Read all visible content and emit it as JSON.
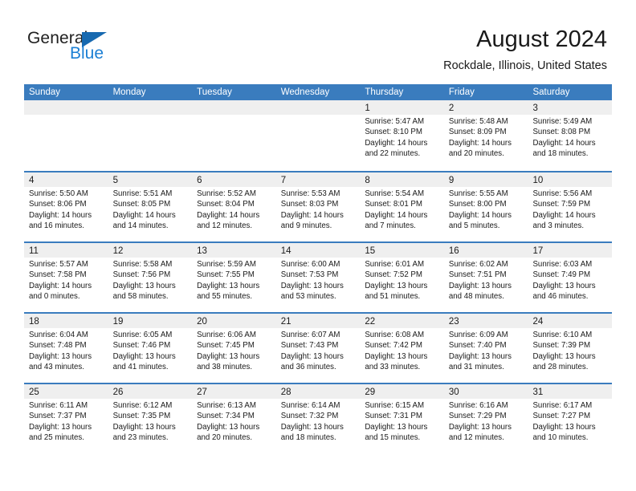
{
  "brand": {
    "name_dark": "General",
    "name_blue": "Blue",
    "triangle_icon": "triangle-icon",
    "accent_color": "#1b7fd4",
    "header_color": "#3a7cbe"
  },
  "header": {
    "title": "August 2024",
    "subtitle": "Rockdale, Illinois, United States"
  },
  "weekdays": [
    "Sunday",
    "Monday",
    "Tuesday",
    "Wednesday",
    "Thursday",
    "Friday",
    "Saturday"
  ],
  "weeks": [
    [
      {
        "day": "",
        "lines": []
      },
      {
        "day": "",
        "lines": []
      },
      {
        "day": "",
        "lines": []
      },
      {
        "day": "",
        "lines": []
      },
      {
        "day": "1",
        "lines": [
          "Sunrise: 5:47 AM",
          "Sunset: 8:10 PM",
          "Daylight: 14 hours",
          "and 22 minutes."
        ]
      },
      {
        "day": "2",
        "lines": [
          "Sunrise: 5:48 AM",
          "Sunset: 8:09 PM",
          "Daylight: 14 hours",
          "and 20 minutes."
        ]
      },
      {
        "day": "3",
        "lines": [
          "Sunrise: 5:49 AM",
          "Sunset: 8:08 PM",
          "Daylight: 14 hours",
          "and 18 minutes."
        ]
      }
    ],
    [
      {
        "day": "4",
        "lines": [
          "Sunrise: 5:50 AM",
          "Sunset: 8:06 PM",
          "Daylight: 14 hours",
          "and 16 minutes."
        ]
      },
      {
        "day": "5",
        "lines": [
          "Sunrise: 5:51 AM",
          "Sunset: 8:05 PM",
          "Daylight: 14 hours",
          "and 14 minutes."
        ]
      },
      {
        "day": "6",
        "lines": [
          "Sunrise: 5:52 AM",
          "Sunset: 8:04 PM",
          "Daylight: 14 hours",
          "and 12 minutes."
        ]
      },
      {
        "day": "7",
        "lines": [
          "Sunrise: 5:53 AM",
          "Sunset: 8:03 PM",
          "Daylight: 14 hours",
          "and 9 minutes."
        ]
      },
      {
        "day": "8",
        "lines": [
          "Sunrise: 5:54 AM",
          "Sunset: 8:01 PM",
          "Daylight: 14 hours",
          "and 7 minutes."
        ]
      },
      {
        "day": "9",
        "lines": [
          "Sunrise: 5:55 AM",
          "Sunset: 8:00 PM",
          "Daylight: 14 hours",
          "and 5 minutes."
        ]
      },
      {
        "day": "10",
        "lines": [
          "Sunrise: 5:56 AM",
          "Sunset: 7:59 PM",
          "Daylight: 14 hours",
          "and 3 minutes."
        ]
      }
    ],
    [
      {
        "day": "11",
        "lines": [
          "Sunrise: 5:57 AM",
          "Sunset: 7:58 PM",
          "Daylight: 14 hours",
          "and 0 minutes."
        ]
      },
      {
        "day": "12",
        "lines": [
          "Sunrise: 5:58 AM",
          "Sunset: 7:56 PM",
          "Daylight: 13 hours",
          "and 58 minutes."
        ]
      },
      {
        "day": "13",
        "lines": [
          "Sunrise: 5:59 AM",
          "Sunset: 7:55 PM",
          "Daylight: 13 hours",
          "and 55 minutes."
        ]
      },
      {
        "day": "14",
        "lines": [
          "Sunrise: 6:00 AM",
          "Sunset: 7:53 PM",
          "Daylight: 13 hours",
          "and 53 minutes."
        ]
      },
      {
        "day": "15",
        "lines": [
          "Sunrise: 6:01 AM",
          "Sunset: 7:52 PM",
          "Daylight: 13 hours",
          "and 51 minutes."
        ]
      },
      {
        "day": "16",
        "lines": [
          "Sunrise: 6:02 AM",
          "Sunset: 7:51 PM",
          "Daylight: 13 hours",
          "and 48 minutes."
        ]
      },
      {
        "day": "17",
        "lines": [
          "Sunrise: 6:03 AM",
          "Sunset: 7:49 PM",
          "Daylight: 13 hours",
          "and 46 minutes."
        ]
      }
    ],
    [
      {
        "day": "18",
        "lines": [
          "Sunrise: 6:04 AM",
          "Sunset: 7:48 PM",
          "Daylight: 13 hours",
          "and 43 minutes."
        ]
      },
      {
        "day": "19",
        "lines": [
          "Sunrise: 6:05 AM",
          "Sunset: 7:46 PM",
          "Daylight: 13 hours",
          "and 41 minutes."
        ]
      },
      {
        "day": "20",
        "lines": [
          "Sunrise: 6:06 AM",
          "Sunset: 7:45 PM",
          "Daylight: 13 hours",
          "and 38 minutes."
        ]
      },
      {
        "day": "21",
        "lines": [
          "Sunrise: 6:07 AM",
          "Sunset: 7:43 PM",
          "Daylight: 13 hours",
          "and 36 minutes."
        ]
      },
      {
        "day": "22",
        "lines": [
          "Sunrise: 6:08 AM",
          "Sunset: 7:42 PM",
          "Daylight: 13 hours",
          "and 33 minutes."
        ]
      },
      {
        "day": "23",
        "lines": [
          "Sunrise: 6:09 AM",
          "Sunset: 7:40 PM",
          "Daylight: 13 hours",
          "and 31 minutes."
        ]
      },
      {
        "day": "24",
        "lines": [
          "Sunrise: 6:10 AM",
          "Sunset: 7:39 PM",
          "Daylight: 13 hours",
          "and 28 minutes."
        ]
      }
    ],
    [
      {
        "day": "25",
        "lines": [
          "Sunrise: 6:11 AM",
          "Sunset: 7:37 PM",
          "Daylight: 13 hours",
          "and 25 minutes."
        ]
      },
      {
        "day": "26",
        "lines": [
          "Sunrise: 6:12 AM",
          "Sunset: 7:35 PM",
          "Daylight: 13 hours",
          "and 23 minutes."
        ]
      },
      {
        "day": "27",
        "lines": [
          "Sunrise: 6:13 AM",
          "Sunset: 7:34 PM",
          "Daylight: 13 hours",
          "and 20 minutes."
        ]
      },
      {
        "day": "28",
        "lines": [
          "Sunrise: 6:14 AM",
          "Sunset: 7:32 PM",
          "Daylight: 13 hours",
          "and 18 minutes."
        ]
      },
      {
        "day": "29",
        "lines": [
          "Sunrise: 6:15 AM",
          "Sunset: 7:31 PM",
          "Daylight: 13 hours",
          "and 15 minutes."
        ]
      },
      {
        "day": "30",
        "lines": [
          "Sunrise: 6:16 AM",
          "Sunset: 7:29 PM",
          "Daylight: 13 hours",
          "and 12 minutes."
        ]
      },
      {
        "day": "31",
        "lines": [
          "Sunrise: 6:17 AM",
          "Sunset: 7:27 PM",
          "Daylight: 13 hours",
          "and 10 minutes."
        ]
      }
    ]
  ]
}
